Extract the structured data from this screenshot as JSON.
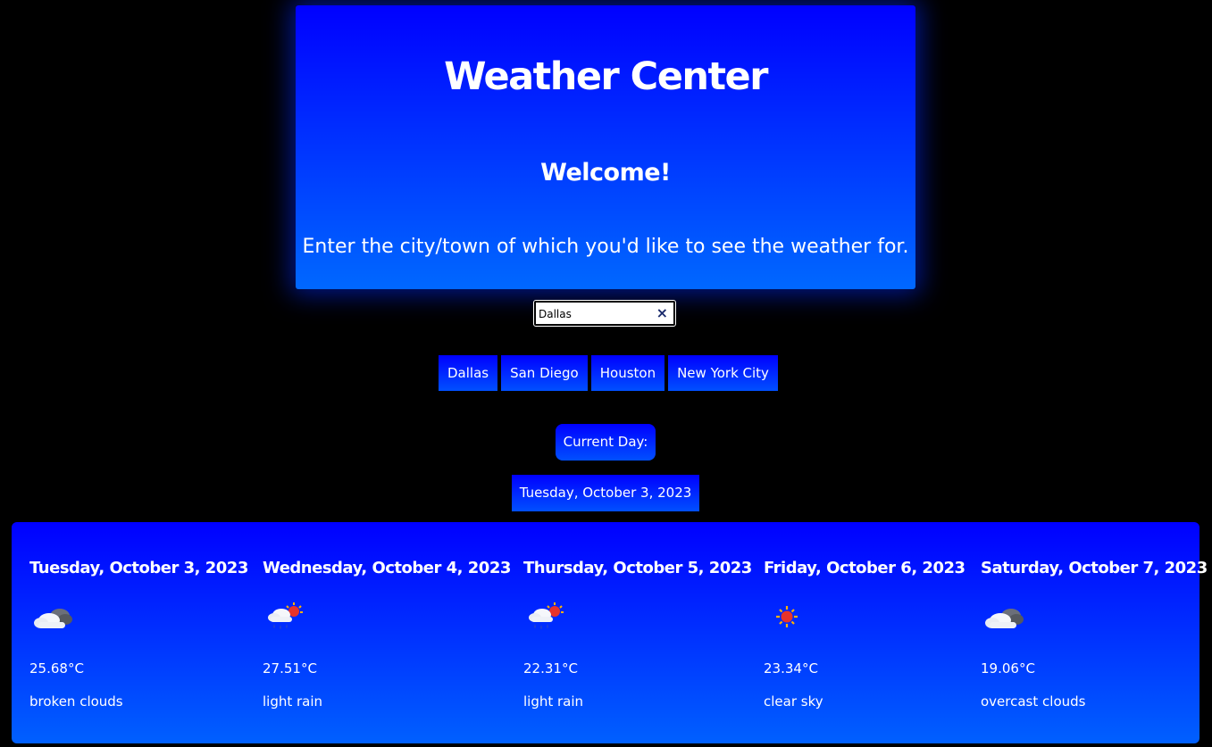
{
  "header": {
    "title": "Weather Center",
    "welcome": "Welcome!",
    "subtitle": "Enter the city/town of which you'd like to see the weather for."
  },
  "search": {
    "value": "Dallas",
    "clear_icon": "×"
  },
  "city_buttons": [
    {
      "label": "Dallas"
    },
    {
      "label": "San Diego"
    },
    {
      "label": "Houston"
    },
    {
      "label": "New York City"
    }
  ],
  "current": {
    "label": "Current Day:",
    "date": "Tuesday, October 3, 2023"
  },
  "forecast": [
    {
      "date": "Tuesday, October 3, 2023",
      "icon": "broken-clouds-icon",
      "temp": "25.68°C",
      "description": "broken clouds"
    },
    {
      "date": "Wednesday, October 4, 2023",
      "icon": "light-rain-icon",
      "temp": "27.51°C",
      "description": "light rain"
    },
    {
      "date": "Thursday, October 5, 2023",
      "icon": "light-rain-icon",
      "temp": "22.31°C",
      "description": "light rain"
    },
    {
      "date": "Friday, October 6, 2023",
      "icon": "clear-sky-icon",
      "temp": "23.34°C",
      "description": "clear sky"
    },
    {
      "date": "Saturday, October 7, 2023",
      "icon": "overcast-clouds-icon",
      "temp": "19.06°C",
      "description": "overcast clouds"
    }
  ],
  "colors": {
    "background": "#000000",
    "panel_top": "#0000ff",
    "panel_bottom": "#0068ff",
    "text": "#ffffff"
  }
}
